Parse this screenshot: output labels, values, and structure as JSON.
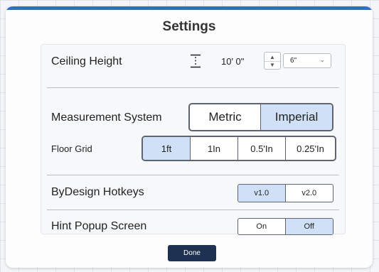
{
  "dialog": {
    "title": "Settings",
    "done_label": "Done"
  },
  "ceiling_height": {
    "label": "Ceiling Height",
    "icon": "height-icon",
    "value": "10' 0\"",
    "step_select": "6\""
  },
  "measurement_system": {
    "label": "Measurement System",
    "options": [
      "Metric",
      "Imperial"
    ],
    "selected": "Imperial"
  },
  "floor_grid": {
    "label": "Floor Grid",
    "options": [
      "1ft",
      "1In",
      "0.5'In",
      "0.25'In"
    ],
    "selected": "1ft"
  },
  "hotkeys": {
    "label": "ByDesign Hotkeys",
    "options": [
      "v1.0",
      "v2.0"
    ],
    "selected": "v1.0"
  },
  "hint_popup": {
    "label": "Hint Popup Screen",
    "options": [
      "On",
      "Off"
    ],
    "selected": "Off"
  },
  "colors": {
    "accent": "#2f6fc3",
    "selected_fill": "#cfe0f7",
    "done_button": "#1f3150"
  }
}
